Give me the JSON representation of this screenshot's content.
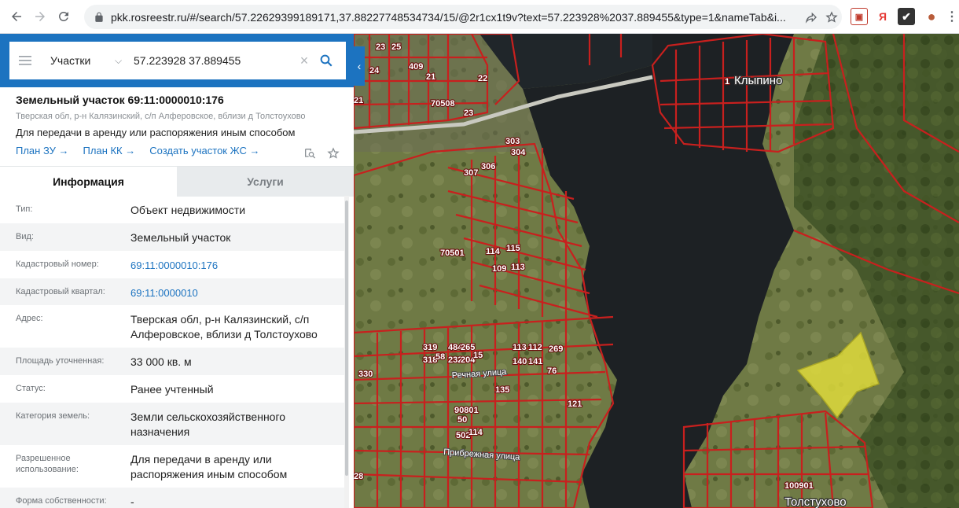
{
  "browser": {
    "url": "pkk.rosreestr.ru/#/search/57.22629399189171,37.88227748534734/15/@2r1cx1t9v?text=57.223928%2037.889455&type=1&nameTab&i...",
    "icons": [
      "back-icon",
      "forward-icon",
      "reload-icon",
      "lock-icon",
      "share-icon",
      "star-icon"
    ],
    "extensions": [
      {
        "name": "pocket-extension-icon",
        "glyph": "▣",
        "color": "#c0392b"
      },
      {
        "name": "yandex-extension-icon",
        "glyph": "Я",
        "color": "#e53935"
      },
      {
        "name": "checkmark-extension-icon",
        "glyph": "✔",
        "color": "#333333"
      },
      {
        "name": "profile-extension-icon",
        "glyph": "●",
        "color": "#b85c3a"
      }
    ]
  },
  "search": {
    "type_label": "Участки",
    "query": "57.223928 37.889455"
  },
  "card": {
    "title": "Земельный участок 69:11:0000010:176",
    "address": "Тверская обл, р-н Калязинский, с/п Алферовское, вблизи д Толстоухово",
    "use": "Для передачи в аренду или распоряжения иным способом",
    "links": [
      "План ЗУ →",
      "План КК →",
      "Создать участок ЖС →"
    ]
  },
  "tabs": {
    "info": "Информация",
    "services": "Услуги"
  },
  "details": [
    {
      "label": "Тип:",
      "value": "Объект недвижимости",
      "link": false
    },
    {
      "label": "Вид:",
      "value": "Земельный участок",
      "link": false
    },
    {
      "label": "Кадастровый номер:",
      "value": "69:11:0000010:176",
      "link": true
    },
    {
      "label": "Кадастровый квартал:",
      "value": "69:11:0000010",
      "link": true
    },
    {
      "label": "Адрес:",
      "value": "Тверская обл, р-н Калязинский, с/п Алферовское, вблизи д Толстоухово",
      "link": false
    },
    {
      "label": "Площадь уточненная:",
      "value": "33 000 кв. м",
      "link": false
    },
    {
      "label": "Статус:",
      "value": "Ранее учтенный",
      "link": false
    },
    {
      "label": "Категория земель:",
      "value": "Земли сельскохозяйственного назначения",
      "link": false
    },
    {
      "label": "Разрешенное использование:",
      "value": "Для передачи в аренду или распоряжения иным способом",
      "link": false
    },
    {
      "label": "Форма собственности:",
      "value": "-",
      "link": false
    }
  ],
  "map": {
    "places": [
      "Клыпино",
      "Толстухово"
    ],
    "streets": [
      "Речная улица",
      "Прибрежная улица"
    ],
    "parcel_labels": [
      "23",
      "25",
      "24",
      "409",
      "21",
      "22",
      "70508",
      "23",
      "21",
      "303",
      "304",
      "307",
      "306",
      "70501",
      "114",
      "115",
      "109",
      "113",
      "319",
      "318",
      "58",
      "484",
      "232",
      "265",
      "204",
      "15",
      "113",
      "112",
      "140",
      "141",
      "269",
      "76",
      "121",
      "330",
      "135",
      "90801",
      "502",
      "50",
      "114",
      "28",
      "1",
      "100901"
    ],
    "colors": {
      "parcel_border": "#c8201e",
      "highlight": "#e6e13c",
      "water": "#1d2124"
    }
  }
}
